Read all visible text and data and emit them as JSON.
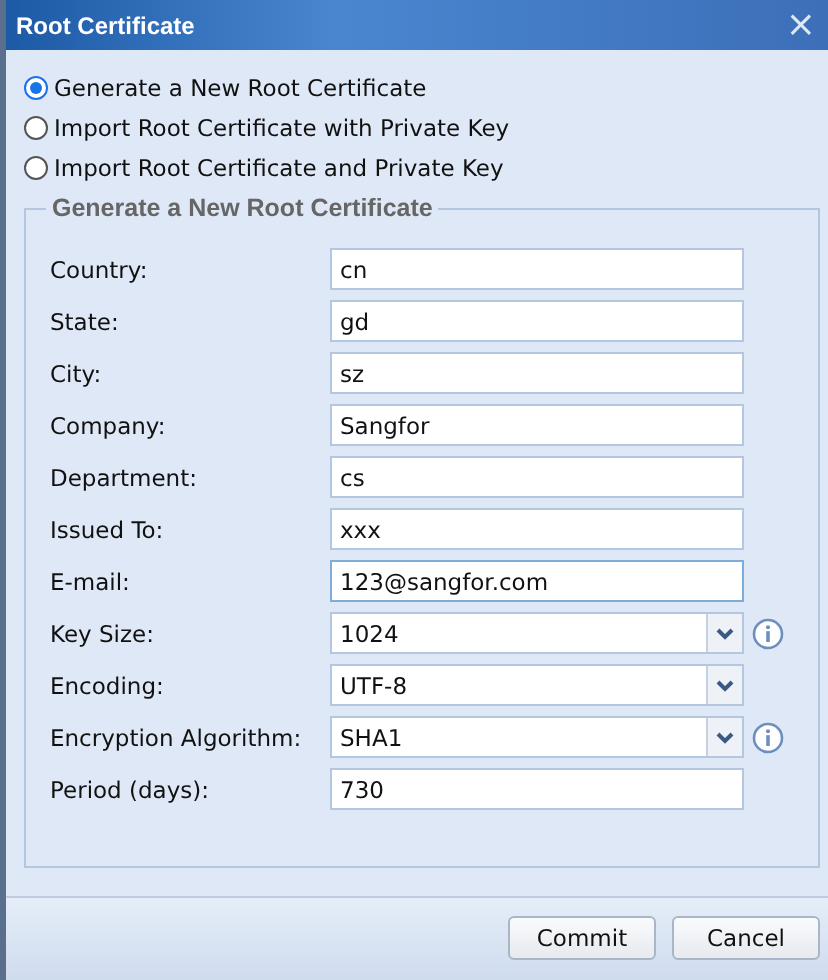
{
  "window": {
    "title": "Root Certificate",
    "close": "×"
  },
  "options": [
    {
      "label": "Generate a New Root Certificate",
      "selected": true
    },
    {
      "label": "Import Root Certificate with Private Key",
      "selected": false
    },
    {
      "label": "Import Root Certificate and Private Key",
      "selected": false
    }
  ],
  "group": {
    "title": "Generate a New Root Certificate",
    "fields": [
      {
        "label": "Country:",
        "kind": "text",
        "value": "cn",
        "focused": false,
        "info": false
      },
      {
        "label": "State:",
        "kind": "text",
        "value": "gd",
        "focused": false,
        "info": false
      },
      {
        "label": "City:",
        "kind": "text",
        "value": "sz",
        "focused": false,
        "info": false
      },
      {
        "label": "Company:",
        "kind": "text",
        "value": "Sangfor",
        "focused": false,
        "info": false
      },
      {
        "label": "Department:",
        "kind": "text",
        "value": "cs",
        "focused": false,
        "info": false
      },
      {
        "label": "Issued To:",
        "kind": "text",
        "value": "xxx",
        "focused": false,
        "info": false
      },
      {
        "label": "E-mail:",
        "kind": "text",
        "value": "123@sangfor.com",
        "focused": true,
        "info": false
      },
      {
        "label": "Key Size:",
        "kind": "select",
        "value": "1024",
        "focused": false,
        "info": true
      },
      {
        "label": "Encoding:",
        "kind": "select",
        "value": "UTF-8",
        "focused": false,
        "info": false
      },
      {
        "label": "Encryption Algorithm:",
        "kind": "select",
        "value": "SHA1",
        "focused": false,
        "info": true
      },
      {
        "label": "Period (days):",
        "kind": "text",
        "value": "730",
        "focused": false,
        "info": false
      }
    ]
  },
  "buttons": [
    "Commit",
    "Cancel"
  ]
}
